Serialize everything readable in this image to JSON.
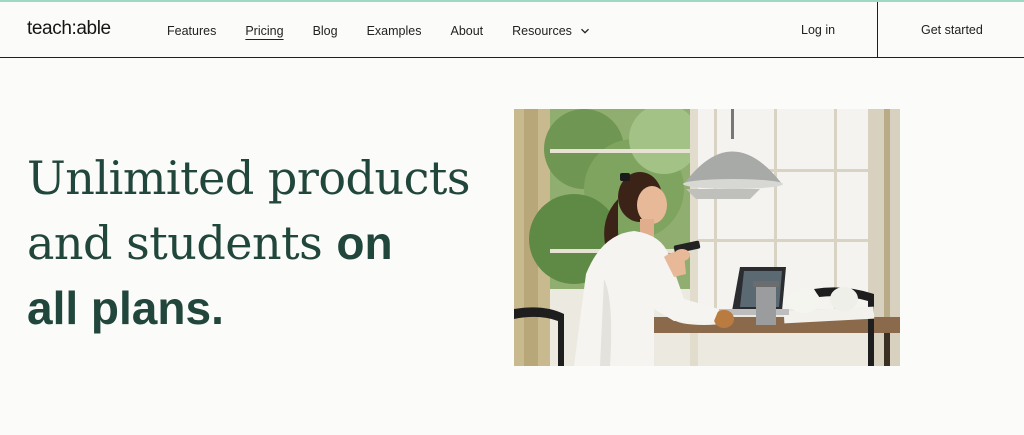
{
  "brand": {
    "logo": "teach:able"
  },
  "nav": {
    "links": [
      {
        "label": "Features"
      },
      {
        "label": "Pricing"
      },
      {
        "label": "Blog"
      },
      {
        "label": "Examples"
      },
      {
        "label": "About"
      },
      {
        "label": "Resources"
      }
    ],
    "login": "Log in",
    "cta": "Get started"
  },
  "hero": {
    "line1": "Unlimited products",
    "line2_serif": "and students ",
    "line2_sans": "on",
    "line3": "all plans."
  },
  "colors": {
    "accent_line": "#9fd9c6",
    "headline": "#21463b"
  },
  "icons": {
    "resources_dropdown": "chevron-down-icon"
  }
}
